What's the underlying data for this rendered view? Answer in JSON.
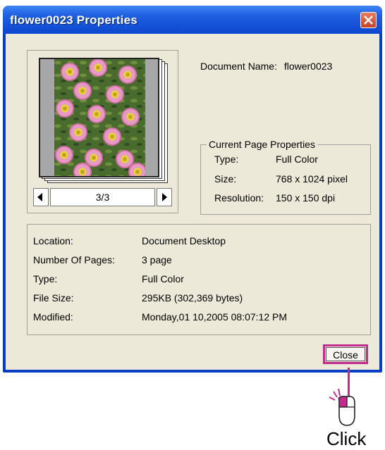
{
  "window": {
    "title": "flower0023 Properties"
  },
  "preview": {
    "page_indicator": "3/3"
  },
  "document": {
    "name_label": "Document Name:",
    "name_value": "flower0023"
  },
  "current_page": {
    "legend": "Current Page Properties",
    "rows": [
      {
        "label": "Type:",
        "value": "Full Color"
      },
      {
        "label": "Size:",
        "value": "768 x 1024 pixel"
      },
      {
        "label": "Resolution:",
        "value": "150 x 150 dpi"
      }
    ]
  },
  "details": {
    "rows": [
      {
        "label": "Location:",
        "value": "Document Desktop"
      },
      {
        "label": "Number Of Pages:",
        "value": "3 page"
      },
      {
        "label": "Type:",
        "value": "Full Color"
      },
      {
        "label": "File Size:",
        "value": "295KB (302,369 bytes)"
      },
      {
        "label": "Modified:",
        "value": "Monday,01 10,2005 08:07:12 PM"
      }
    ]
  },
  "buttons": {
    "close_label": "Close"
  },
  "annotation": {
    "click_label": "Click"
  },
  "colors": {
    "highlight": "#c22a8c",
    "titlebar": "#0b47d0",
    "dialog_bg": "#ece9d8"
  },
  "icons": [
    "close-x-icon",
    "arrow-left-icon",
    "arrow-right-icon",
    "mouse-icon"
  ]
}
